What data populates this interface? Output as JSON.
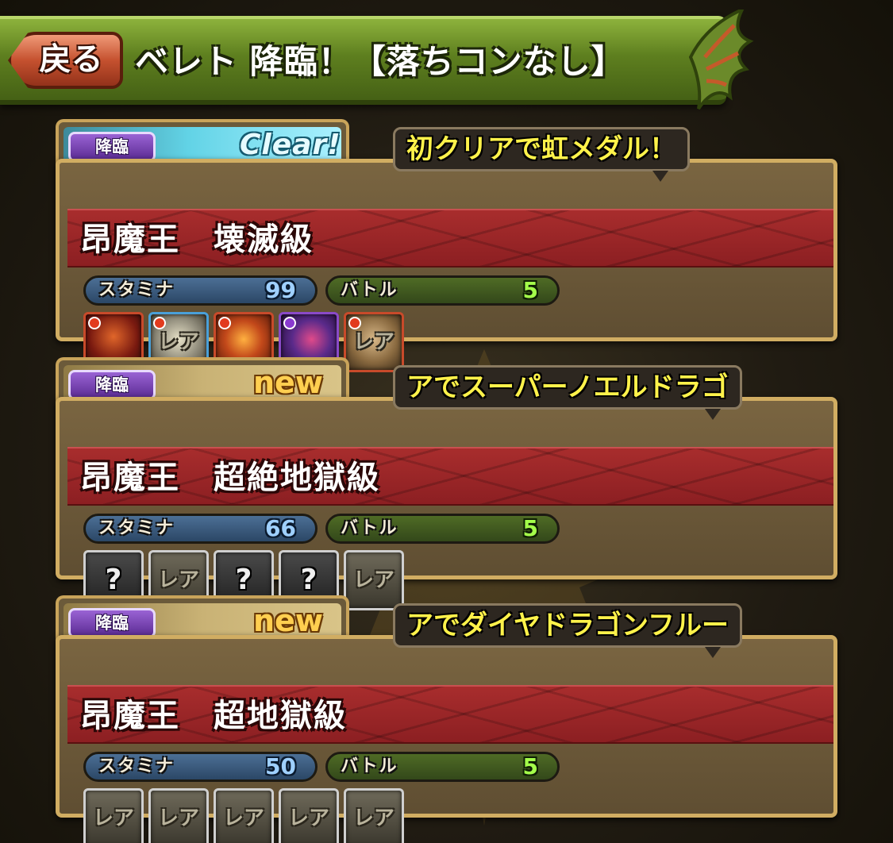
{
  "header": {
    "back_label": "戻る",
    "title": "ベレト 降臨！【落ちコンなし】"
  },
  "colors": {
    "header_green": "#5e7f1f",
    "back_red": "#c5512f",
    "banner_red": "#a82d2d",
    "card_frame_gold": "#d1ad62",
    "descent_purple": "#5b2c94",
    "reward_yellow": "#fff24a"
  },
  "dungeons": [
    {
      "badge": "降臨",
      "status": "Clear!",
      "name": "昂魔王　壊滅級",
      "reward": "初クリアで虹メダル！",
      "stamina_label": "スタミナ",
      "stamina": "99",
      "battle_label": "バトル",
      "battles": "5",
      "drops": [
        {
          "icon": "fire-demon-monster-icon",
          "type": "monster"
        },
        {
          "icon": "rare-orb-monster-icon",
          "type": "monster",
          "text": "レア"
        },
        {
          "icon": "fire-dragon-monster-icon",
          "type": "monster"
        },
        {
          "icon": "dark-dragon-monster-icon",
          "type": "monster"
        },
        {
          "icon": "gold-rare-monster-icon",
          "type": "monster",
          "text": "レア"
        }
      ]
    },
    {
      "badge": "降臨",
      "status": "new",
      "name": "昂魔王　超絶地獄級",
      "reward": "アでスーパーノエルドラゴ",
      "stamina_label": "スタミナ",
      "stamina": "66",
      "battle_label": "バトル",
      "battles": "5",
      "drops": [
        {
          "icon": "unknown-drop-icon",
          "type": "unknown",
          "text": "?"
        },
        {
          "icon": "rare-drop-icon",
          "type": "rare",
          "text": "レア"
        },
        {
          "icon": "unknown-drop-icon",
          "type": "unknown",
          "text": "?"
        },
        {
          "icon": "unknown-drop-icon",
          "type": "unknown",
          "text": "?"
        },
        {
          "icon": "rare-drop-icon",
          "type": "rare",
          "text": "レア"
        }
      ]
    },
    {
      "badge": "降臨",
      "status": "new",
      "name": "昂魔王　超地獄級",
      "reward": "アでダイヤドラゴンフルー",
      "stamina_label": "スタミナ",
      "stamina": "50",
      "battle_label": "バトル",
      "battles": "5",
      "drops": [
        {
          "icon": "rare-drop-icon",
          "type": "rare",
          "text": "レア"
        },
        {
          "icon": "rare-drop-icon",
          "type": "rare",
          "text": "レア"
        },
        {
          "icon": "rare-drop-icon",
          "type": "rare",
          "text": "レア"
        },
        {
          "icon": "rare-drop-icon",
          "type": "rare",
          "text": "レア"
        },
        {
          "icon": "rare-drop-icon",
          "type": "rare",
          "text": "レア"
        }
      ]
    }
  ]
}
